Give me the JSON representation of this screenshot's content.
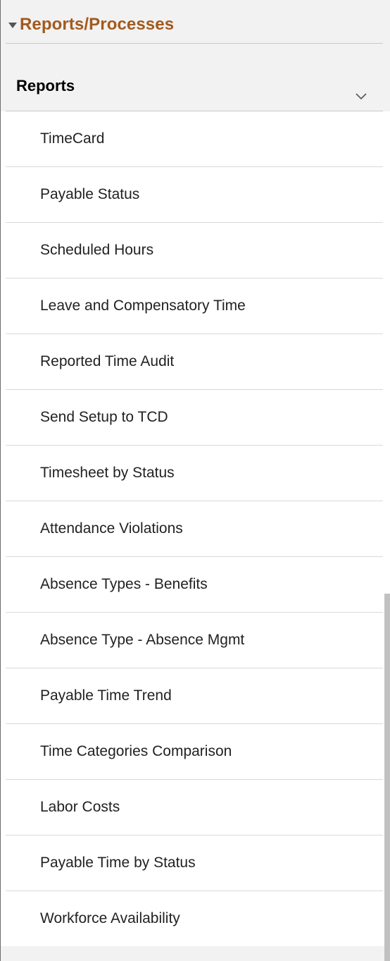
{
  "section": {
    "title": "Reports/Processes",
    "expand_icon": "triangle-down-icon"
  },
  "group": {
    "title": "Reports",
    "toggle_icon": "chevron-down-icon"
  },
  "reports": {
    "items": [
      {
        "label": "TimeCard"
      },
      {
        "label": "Payable Status"
      },
      {
        "label": "Scheduled Hours"
      },
      {
        "label": "Leave and Compensatory Time"
      },
      {
        "label": "Reported Time Audit"
      },
      {
        "label": "Send Setup to TCD"
      },
      {
        "label": "Timesheet by Status"
      },
      {
        "label": "Attendance Violations"
      },
      {
        "label": "Absence Types - Benefits"
      },
      {
        "label": "Absence Type - Absence Mgmt"
      },
      {
        "label": "Payable Time Trend"
      },
      {
        "label": "Time Categories Comparison"
      },
      {
        "label": "Labor Costs"
      },
      {
        "label": "Payable Time by Status"
      },
      {
        "label": "Workforce Availability"
      }
    ]
  },
  "colors": {
    "section_title": "#a25a1e",
    "header_bg": "#f2f2f2",
    "divider": "#d9d9d9"
  }
}
